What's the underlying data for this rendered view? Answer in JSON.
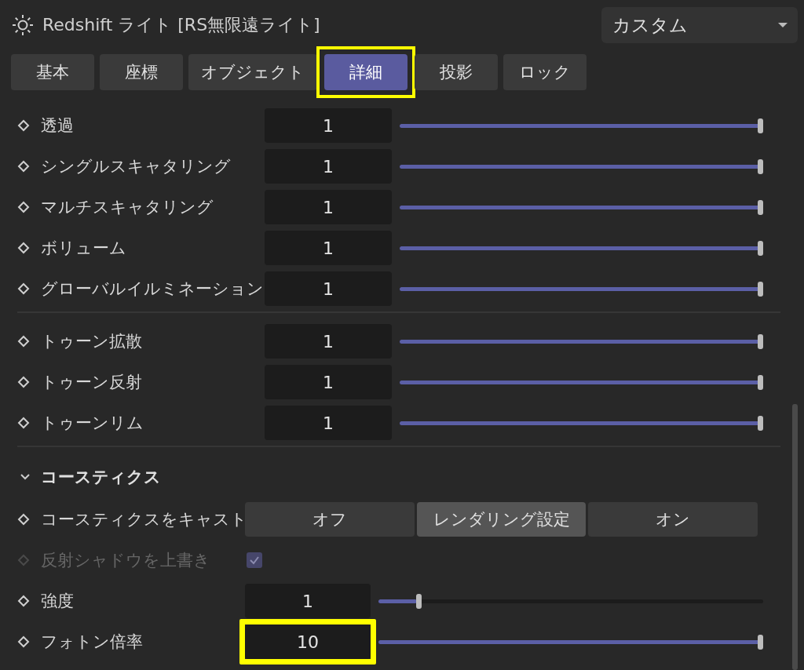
{
  "panel": {
    "title": "Redshift ライト [RS無限遠ライト]",
    "preset": "カスタム"
  },
  "tabs": [
    {
      "label": "基本",
      "selected": false,
      "highlighted": false
    },
    {
      "label": "座標",
      "selected": false,
      "highlighted": false
    },
    {
      "label": "オブジェクト",
      "selected": false,
      "highlighted": false
    },
    {
      "label": "詳細",
      "selected": true,
      "highlighted": true
    },
    {
      "label": "投影",
      "selected": false,
      "highlighted": false
    },
    {
      "label": "ロック",
      "selected": false,
      "highlighted": false
    }
  ],
  "groups": [
    {
      "rows": [
        {
          "kind": "slider",
          "label": "透過",
          "value": "1",
          "level": 1,
          "disabled": false,
          "highlighted": false
        },
        {
          "kind": "slider",
          "label": "シングルスキャタリング",
          "value": "1",
          "level": 1,
          "disabled": false,
          "highlighted": false
        },
        {
          "kind": "slider",
          "label": "マルチスキャタリング",
          "value": "1",
          "level": 1,
          "disabled": false,
          "highlighted": false
        },
        {
          "kind": "slider",
          "label": "ボリューム",
          "value": "1",
          "level": 1,
          "disabled": false,
          "highlighted": false
        },
        {
          "kind": "slider",
          "label": "グローバルイルミネーション",
          "value": "1",
          "level": 1,
          "disabled": false,
          "highlighted": false
        }
      ]
    },
    {
      "rows": [
        {
          "kind": "slider",
          "label": "トゥーン拡散",
          "value": "1",
          "level": 1,
          "disabled": false,
          "highlighted": false
        },
        {
          "kind": "slider",
          "label": "トゥーン反射",
          "value": "1",
          "level": 1,
          "disabled": false,
          "highlighted": false
        },
        {
          "kind": "slider",
          "label": "トゥーンリム",
          "value": "1",
          "level": 1,
          "disabled": false,
          "highlighted": false
        }
      ]
    }
  ],
  "section": {
    "title": "コースティクス",
    "expanded": true,
    "rows": [
      {
        "kind": "segmented",
        "label": "コースティクスをキャスト",
        "disabled": false,
        "highlighted": false,
        "options": [
          {
            "label": "オフ",
            "selected": false
          },
          {
            "label": "レンダリング設定",
            "selected": true
          },
          {
            "label": "オン",
            "selected": false
          }
        ]
      },
      {
        "kind": "checkbox",
        "label": "反射シャドウを上書き",
        "checked": true,
        "disabled": true,
        "highlighted": false
      },
      {
        "kind": "slider",
        "label": "強度",
        "value": "1",
        "level": 0.1,
        "disabled": false,
        "highlighted": false
      },
      {
        "kind": "slider",
        "label": "フォトン倍率",
        "value": "10",
        "level": 1,
        "disabled": false,
        "highlighted": true
      }
    ]
  }
}
